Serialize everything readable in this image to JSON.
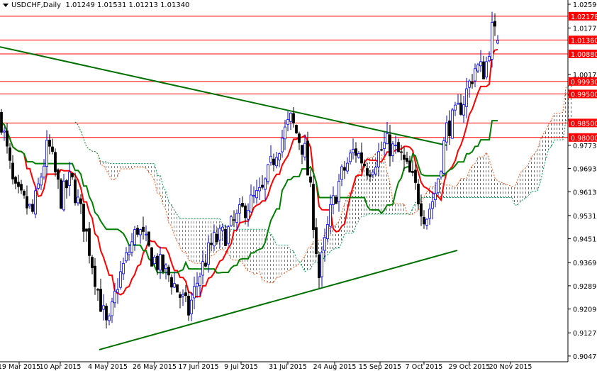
{
  "header": {
    "symbol": "USDCHF,Daily",
    "ohlc": "1.01249 1.01531 1.01213 1.01340"
  },
  "chart_data": {
    "type": "candlestick",
    "title": "USDCHF,Daily",
    "last_bar": {
      "open": 1.01249,
      "high": 1.01531,
      "low": 1.01213,
      "close": 1.0134
    },
    "ylim": [
      0.9047,
      1.0259
    ],
    "y_ticks": [
      "1.02590",
      "1.01770",
      "1.00170",
      "0.97730",
      "0.96930",
      "0.96130",
      "0.95310",
      "0.94510",
      "0.93690",
      "0.92890",
      "0.92090",
      "0.91270",
      "0.90470"
    ],
    "x_ticks": [
      {
        "bar": 6.25,
        "label": "19 Mar 2015"
      },
      {
        "bar": 20.75,
        "label": "10 Apr 2015"
      },
      {
        "bar": 37.5,
        "label": "4 May 2015"
      },
      {
        "bar": 54,
        "label": "26 May 2015"
      },
      {
        "bar": 69.5,
        "label": "17 Jun 2015"
      },
      {
        "bar": 84.5,
        "label": "9 Jul 2015"
      },
      {
        "bar": 101,
        "label": "31 Jul 2015"
      },
      {
        "bar": 117.5,
        "label": "24 Aug 2015"
      },
      {
        "bar": 133.5,
        "label": "15 Sep 2015"
      },
      {
        "bar": 149,
        "label": "7 Oct 2015"
      },
      {
        "bar": 165,
        "label": "29 Oct 2015"
      },
      {
        "bar": 179.5,
        "label": "20 Nov 2015"
      }
    ],
    "bar_count": 176,
    "close_keypoints": [
      [
        0,
        0.9858
      ],
      [
        4.5,
        0.9614
      ],
      [
        11,
        0.954
      ],
      [
        16.5,
        0.978
      ],
      [
        21,
        0.959
      ],
      [
        24.5,
        0.966
      ],
      [
        29.5,
        0.949
      ],
      [
        34.5,
        0.925
      ],
      [
        37.5,
        0.913
      ],
      [
        41,
        0.93
      ],
      [
        48,
        0.949
      ],
      [
        53,
        0.939
      ],
      [
        59.5,
        0.932
      ],
      [
        66,
        0.92
      ],
      [
        69.5,
        0.932
      ],
      [
        74.5,
        0.944
      ],
      [
        79.5,
        0.947
      ],
      [
        86,
        0.956
      ],
      [
        92,
        0.961
      ],
      [
        97,
        0.976
      ],
      [
        102,
        0.986
      ],
      [
        107,
        0.975
      ],
      [
        109.5,
        0.957
      ],
      [
        112,
        0.932
      ],
      [
        116,
        0.954
      ],
      [
        119.5,
        0.966
      ],
      [
        124.5,
        0.976
      ],
      [
        129.5,
        0.969
      ],
      [
        135.5,
        0.978
      ],
      [
        140.5,
        0.974
      ],
      [
        145.5,
        0.964
      ],
      [
        149.5,
        0.952
      ],
      [
        153,
        0.961
      ],
      [
        157,
        0.983
      ],
      [
        160.5,
        0.988
      ],
      [
        163,
        0.993
      ],
      [
        167,
        1.004
      ],
      [
        170.5,
        1.003
      ],
      [
        173,
        1.017
      ],
      [
        175,
        1.0134
      ]
    ],
    "indicator": "Ichimoku Kinko Hyo (9, 26, 52)",
    "horizontal_levels": [
      "1.02178",
      "1.01360",
      "1.00880",
      "0.99930",
      "0.99500",
      "0.98500",
      "0.98000"
    ],
    "trendlines": [
      {
        "name": "descending",
        "from": [
          -0.5,
          1.0112
        ],
        "to": [
          157,
          0.9773
        ]
      },
      {
        "name": "ascending",
        "from": [
          34.5,
          0.9069
        ],
        "to": [
          160.75,
          0.9411
        ]
      }
    ],
    "colors": {
      "bull": "#0000ff",
      "bear": "#000000",
      "level": "#ff0000",
      "trend": "#007000",
      "tenkan": "#ff0000",
      "kijun": "#008000",
      "cloud_up": "#00a050",
      "cloud_down": "#ff5a1e"
    }
  }
}
